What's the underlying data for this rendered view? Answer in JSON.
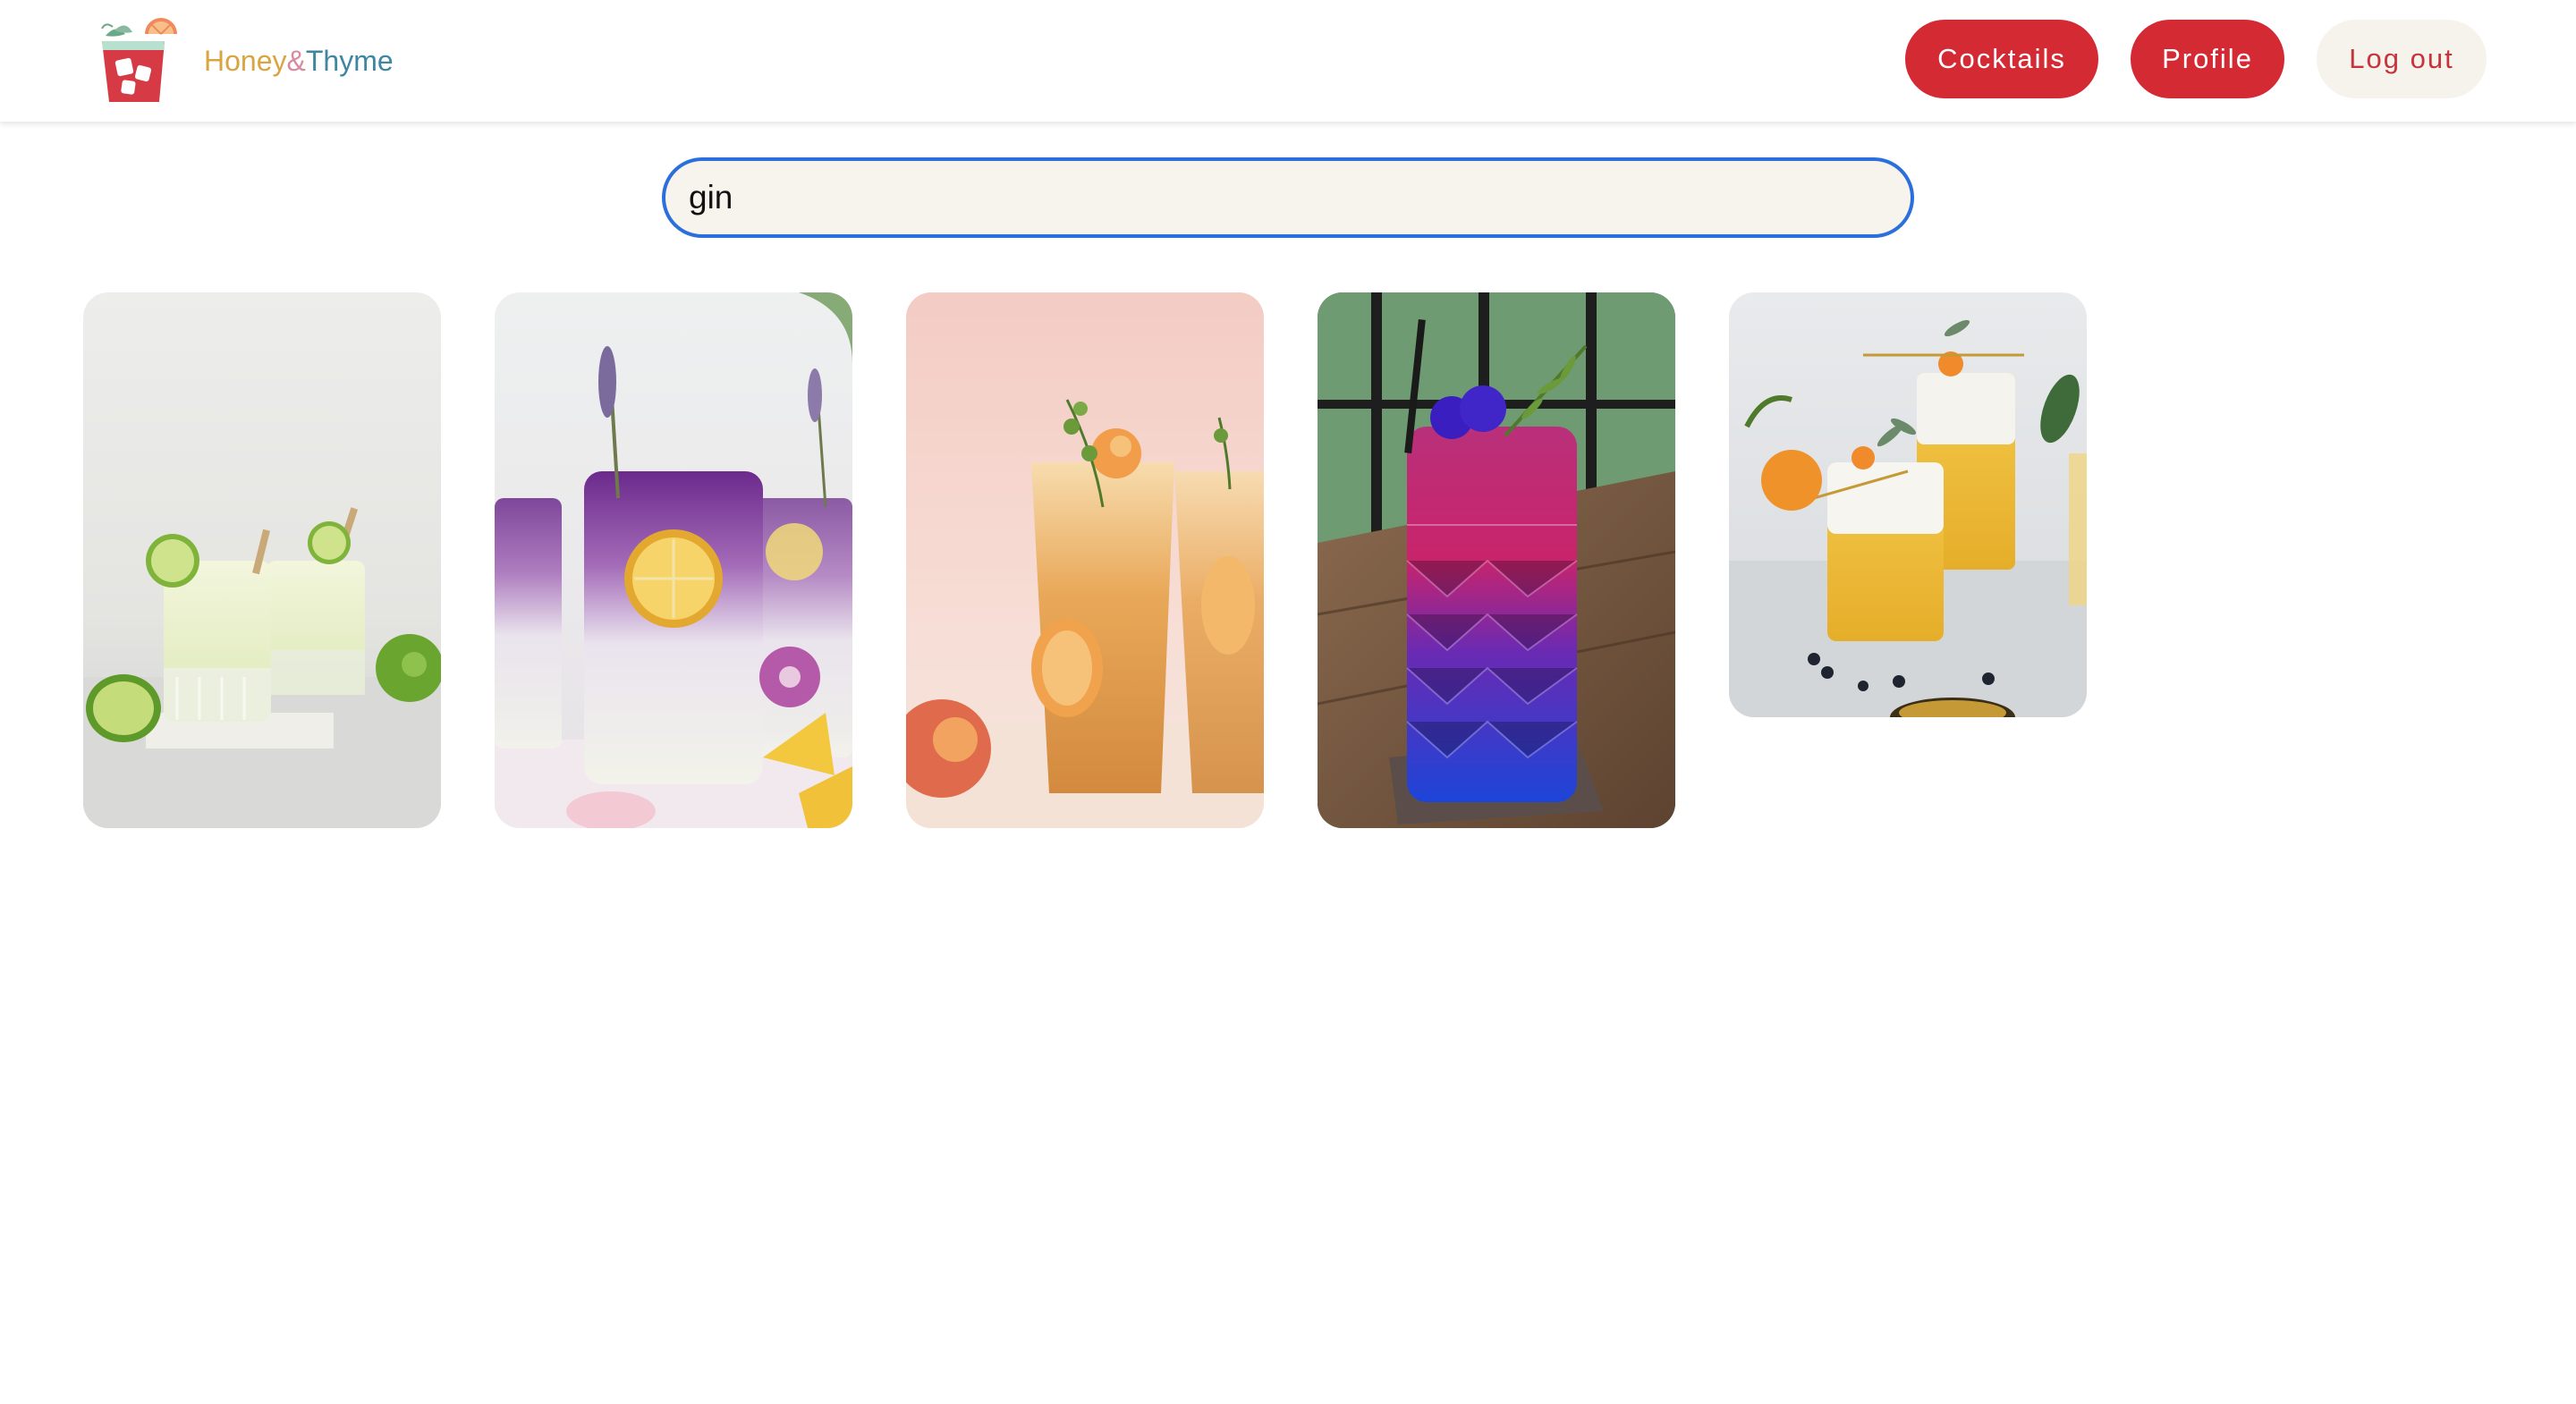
{
  "header": {
    "brand": {
      "honey": "Honey",
      "amp": "&",
      "thyme": "Thyme"
    },
    "logo_icon": "cocktail-glass-logo-icon",
    "nav": {
      "cocktails": "Cocktails",
      "profile": "Profile",
      "logout": "Log out"
    }
  },
  "search": {
    "value": "gin",
    "placeholder": ""
  },
  "results": [
    {
      "image": "frozen-lime-gin-cocktail"
    },
    {
      "image": "butterfly-pea-lemon-gin-cocktail"
    },
    {
      "image": "peach-thyme-gin-cocktail"
    },
    {
      "image": "purple-blue-gin-cocktail-rosemary"
    },
    {
      "image": "citrus-foam-gin-sour-cocktail"
    }
  ],
  "colors": {
    "brand_red": "#d42a33",
    "logout_bg": "#f6f3ec",
    "search_focus": "#2a6fdb",
    "search_bg": "#f7f4ee",
    "brand_honey": "#d9a441",
    "brand_amp": "#d88a9e",
    "brand_thyme": "#3f86a0"
  }
}
